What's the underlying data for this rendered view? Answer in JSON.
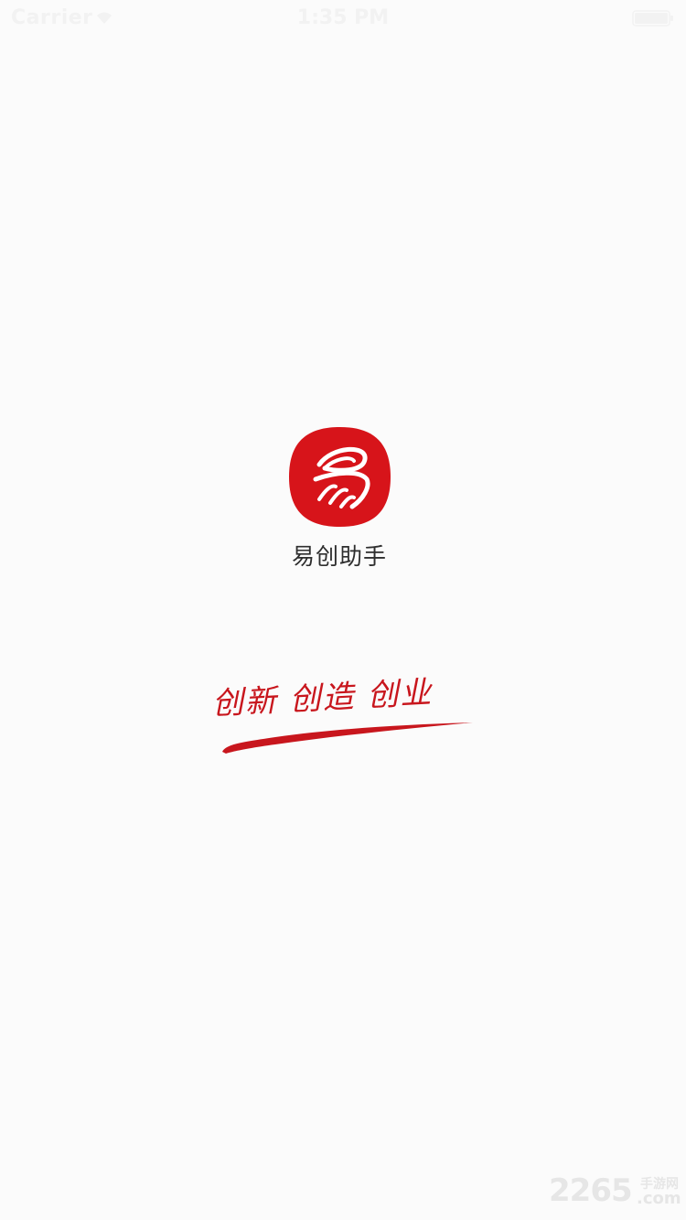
{
  "status_bar": {
    "carrier": "Carrier",
    "wifi_icon": "wifi-icon",
    "time": "1:35 PM",
    "battery_icon": "battery-icon"
  },
  "splash": {
    "app_icon": "yi-logo-icon",
    "app_name": "易创助手",
    "slogan": "创新 创造 创业"
  },
  "watermark": {
    "number": "2265",
    "sub": "手游网",
    "domain": ".com"
  },
  "colors": {
    "brand_red": "#d7141a",
    "slogan_red": "#c8161d",
    "background": "#fbfbfb"
  }
}
